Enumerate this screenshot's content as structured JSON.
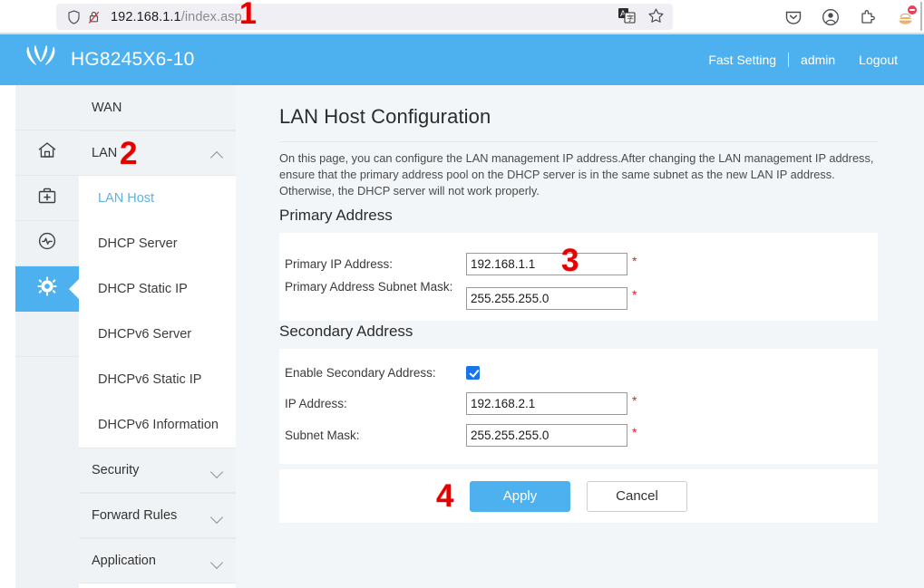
{
  "browser": {
    "url_host": "192.168.1.1",
    "url_path": "/index.asp",
    "icons": {
      "shield": "shield-icon",
      "lock_crossed": "lock-crossed-icon",
      "translate": "translate-icon",
      "bookmark": "star-bookmark-icon",
      "pocket": "pocket-icon",
      "account": "account-icon",
      "extensions": "extensions-icon",
      "profile": "profile-avatar-icon"
    }
  },
  "header": {
    "logo": "huawei-logo-icon",
    "title": "HG8245X6-10",
    "links": [
      {
        "label": "Fast Setting",
        "name": "fast-setting-link"
      },
      {
        "label": "admin",
        "name": "admin-link"
      },
      {
        "label": "Logout",
        "name": "logout-link"
      }
    ]
  },
  "rail": [
    {
      "name": "home-icon",
      "active": false
    },
    {
      "name": "toolbox-plus-icon",
      "active": false
    },
    {
      "name": "diagnosis-wave-icon",
      "active": false
    },
    {
      "name": "gear-icon",
      "active": true
    }
  ],
  "sidebar": {
    "groups": [
      {
        "label": "WAN",
        "name": "sidebar-group-wan",
        "expanded": false,
        "chevron": "none"
      },
      {
        "label": "LAN",
        "name": "sidebar-group-lan",
        "expanded": true,
        "chevron": "chevron-up-icon"
      }
    ],
    "lan_items": [
      {
        "label": "LAN Host",
        "name": "sidebar-item-lan-host",
        "active": true
      },
      {
        "label": "DHCP Server",
        "name": "sidebar-item-dhcp-server",
        "active": false
      },
      {
        "label": "DHCP Static IP",
        "name": "sidebar-item-dhcp-static-ip",
        "active": false
      },
      {
        "label": "DHCPv6 Server",
        "name": "sidebar-item-dhcpv6-server",
        "active": false
      },
      {
        "label": "DHCPv6 Static IP",
        "name": "sidebar-item-dhcpv6-static-ip",
        "active": false
      },
      {
        "label": "DHCPv6 Information",
        "name": "sidebar-item-dhcpv6-information",
        "active": false
      }
    ],
    "bottom_groups": [
      {
        "label": "Security",
        "name": "sidebar-group-security",
        "chevron": "chevron-down-icon"
      },
      {
        "label": "Forward Rules",
        "name": "sidebar-group-forward-rules",
        "chevron": "chevron-down-icon"
      },
      {
        "label": "Application",
        "name": "sidebar-group-application",
        "chevron": "chevron-down-icon"
      }
    ]
  },
  "main": {
    "title": "LAN Host Configuration",
    "description": "On this page, you can configure the LAN management IP address.After changing the LAN management IP address, ensure that the primary address pool on the DHCP server is in the same subnet as the new LAN IP address. Otherwise, the DHCP server will not work properly.",
    "primary": {
      "section_title": "Primary Address",
      "ip_label": "Primary IP Address:",
      "ip_value": "192.168.1.1",
      "mask_label": "Primary Address Subnet Mask:",
      "mask_value": "255.255.255.0",
      "required_mark": "*"
    },
    "secondary": {
      "section_title": "Secondary Address",
      "enable_label": "Enable Secondary Address:",
      "enable_checked": true,
      "ip_label": "IP Address:",
      "ip_value": "192.168.2.1",
      "mask_label": "Subnet Mask:",
      "mask_value": "255.255.255.0",
      "required_mark": "*"
    },
    "actions": {
      "apply_label": "Apply",
      "cancel_label": "Cancel"
    }
  },
  "annotations": [
    {
      "label": "1",
      "name": "annotation-marker-1"
    },
    {
      "label": "2",
      "name": "annotation-marker-2"
    },
    {
      "label": "3",
      "name": "annotation-marker-3"
    },
    {
      "label": "4",
      "name": "annotation-marker-4"
    }
  ],
  "colors": {
    "brand_blue": "#4db1ef",
    "accent_link": "#58b3e8",
    "required_red": "#e02020",
    "annotation_red": "#e60000",
    "checkbox_blue": "#1a73e8"
  }
}
